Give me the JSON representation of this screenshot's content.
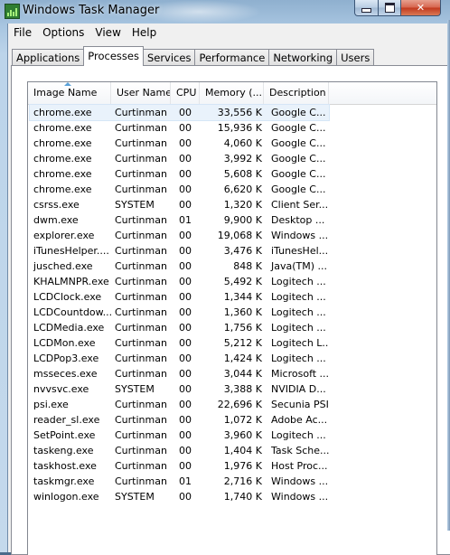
{
  "window": {
    "title": "Windows Task Manager",
    "minimize_glyph": "minimize-icon",
    "maximize_glyph": "maximize-icon",
    "close_glyph": "✕"
  },
  "menu": [
    "File",
    "Options",
    "View",
    "Help"
  ],
  "tabs": [
    "Applications",
    "Processes",
    "Services",
    "Performance",
    "Networking",
    "Users"
  ],
  "active_tab": "Processes",
  "table": {
    "columns": [
      "Image Name",
      "User Name",
      "CPU",
      "Memory (...",
      "Description"
    ],
    "sorted_by": "Image Name",
    "selected_row": 0,
    "rows": [
      {
        "name": "chrome.exe",
        "user": "Curtinman",
        "cpu": "00",
        "mem": "33,556 K",
        "desc": "Google C..."
      },
      {
        "name": "chrome.exe",
        "user": "Curtinman",
        "cpu": "00",
        "mem": "15,936 K",
        "desc": "Google C..."
      },
      {
        "name": "chrome.exe",
        "user": "Curtinman",
        "cpu": "00",
        "mem": "4,060 K",
        "desc": "Google C..."
      },
      {
        "name": "chrome.exe",
        "user": "Curtinman",
        "cpu": "00",
        "mem": "3,992 K",
        "desc": "Google C..."
      },
      {
        "name": "chrome.exe",
        "user": "Curtinman",
        "cpu": "00",
        "mem": "5,608 K",
        "desc": "Google C..."
      },
      {
        "name": "chrome.exe",
        "user": "Curtinman",
        "cpu": "00",
        "mem": "6,620 K",
        "desc": "Google C..."
      },
      {
        "name": "csrss.exe",
        "user": "SYSTEM",
        "cpu": "00",
        "mem": "1,320 K",
        "desc": "Client Ser..."
      },
      {
        "name": "dwm.exe",
        "user": "Curtinman",
        "cpu": "01",
        "mem": "9,900 K",
        "desc": "Desktop ..."
      },
      {
        "name": "explorer.exe",
        "user": "Curtinman",
        "cpu": "00",
        "mem": "19,068 K",
        "desc": "Windows ..."
      },
      {
        "name": "iTunesHelper....",
        "user": "Curtinman",
        "cpu": "00",
        "mem": "3,476 K",
        "desc": "iTunesHel..."
      },
      {
        "name": "jusched.exe",
        "user": "Curtinman",
        "cpu": "00",
        "mem": "848 K",
        "desc": "Java(TM) ..."
      },
      {
        "name": "KHALMNPR.exe",
        "user": "Curtinman",
        "cpu": "00",
        "mem": "5,492 K",
        "desc": "Logitech ..."
      },
      {
        "name": "LCDClock.exe",
        "user": "Curtinman",
        "cpu": "00",
        "mem": "1,344 K",
        "desc": "Logitech ..."
      },
      {
        "name": "LCDCountdow...",
        "user": "Curtinman",
        "cpu": "00",
        "mem": "1,360 K",
        "desc": "Logitech ..."
      },
      {
        "name": "LCDMedia.exe",
        "user": "Curtinman",
        "cpu": "00",
        "mem": "1,756 K",
        "desc": "Logitech ..."
      },
      {
        "name": "LCDMon.exe",
        "user": "Curtinman",
        "cpu": "00",
        "mem": "5,212 K",
        "desc": "Logitech L..."
      },
      {
        "name": "LCDPop3.exe",
        "user": "Curtinman",
        "cpu": "00",
        "mem": "1,424 K",
        "desc": "Logitech ..."
      },
      {
        "name": "msseces.exe",
        "user": "Curtinman",
        "cpu": "00",
        "mem": "3,044 K",
        "desc": "Microsoft ..."
      },
      {
        "name": "nvvsvc.exe",
        "user": "SYSTEM",
        "cpu": "00",
        "mem": "3,388 K",
        "desc": "NVIDIA D..."
      },
      {
        "name": "psi.exe",
        "user": "Curtinman",
        "cpu": "00",
        "mem": "22,696 K",
        "desc": "Secunia PSI"
      },
      {
        "name": "reader_sl.exe",
        "user": "Curtinman",
        "cpu": "00",
        "mem": "1,072 K",
        "desc": "Adobe Ac..."
      },
      {
        "name": "SetPoint.exe",
        "user": "Curtinman",
        "cpu": "00",
        "mem": "3,960 K",
        "desc": "Logitech ..."
      },
      {
        "name": "taskeng.exe",
        "user": "Curtinman",
        "cpu": "00",
        "mem": "1,404 K",
        "desc": "Task Sche..."
      },
      {
        "name": "taskhost.exe",
        "user": "Curtinman",
        "cpu": "00",
        "mem": "1,976 K",
        "desc": "Host Proc..."
      },
      {
        "name": "taskmgr.exe",
        "user": "Curtinman",
        "cpu": "01",
        "mem": "2,716 K",
        "desc": "Windows ..."
      },
      {
        "name": "winlogon.exe",
        "user": "SYSTEM",
        "cpu": "00",
        "mem": "1,740 K",
        "desc": "Windows ..."
      }
    ]
  }
}
